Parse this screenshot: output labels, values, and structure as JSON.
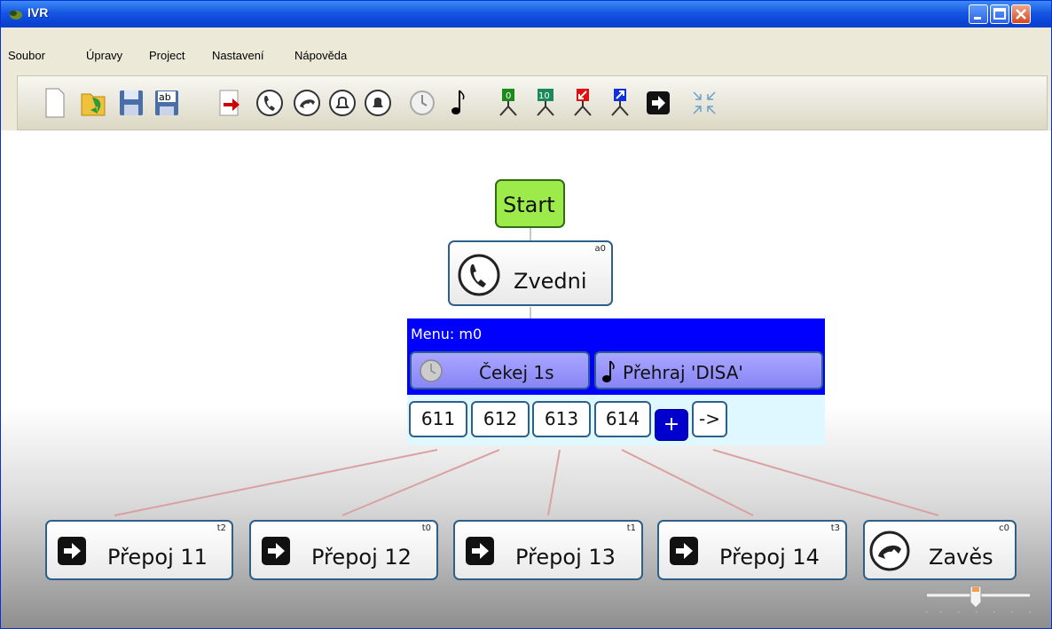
{
  "window": {
    "title": "IVR"
  },
  "menu": [
    "Soubor",
    "Úpravy",
    "Project",
    "Nastavení",
    "Nápověda"
  ],
  "toolbar": {
    "groups": [
      [
        "new-file-icon",
        "open-folder-icon",
        "save-icon",
        "save-as-icon"
      ],
      [
        "export-icon"
      ],
      [
        "pickup-phone-icon",
        "hangup-phone-icon",
        "bell-icon",
        "bell-filled-icon",
        "clock-icon",
        "music-note-icon"
      ],
      [
        "branch-0-icon",
        "branch-10-icon",
        "branch-red-icon",
        "branch-blue-icon",
        "arrow-right-icon"
      ],
      [
        "collapse-icon"
      ]
    ],
    "branch_labels": [
      "0",
      "10"
    ]
  },
  "flow": {
    "start": {
      "label": "Start"
    },
    "pickup": {
      "label": "Zvedni",
      "tag": "a0"
    },
    "menu": {
      "title": "Menu: m0",
      "actions": [
        {
          "label": "Čekej 1s",
          "icon": "clock-icon"
        },
        {
          "label": "Přehraj 'DISA'",
          "icon": "music-note-icon"
        }
      ],
      "keys": [
        "611",
        "612",
        "613",
        "614"
      ],
      "plus": "+",
      "arrow": "->"
    },
    "targets": [
      {
        "label": "Přepoj 11",
        "tag": "t2",
        "icon": "transfer-icon"
      },
      {
        "label": "Přepoj 12",
        "tag": "t0",
        "icon": "transfer-icon"
      },
      {
        "label": "Přepoj 13",
        "tag": "t1",
        "icon": "transfer-icon"
      },
      {
        "label": "Přepoj 14",
        "tag": "t3",
        "icon": "transfer-icon"
      },
      {
        "label": "Zavěs",
        "tag": "c0",
        "icon": "hangup-icon"
      }
    ]
  },
  "colors": {
    "menu_bg": "#0000ff",
    "start_bg": "#9ceb4b",
    "connector": "#d9a1a1"
  }
}
